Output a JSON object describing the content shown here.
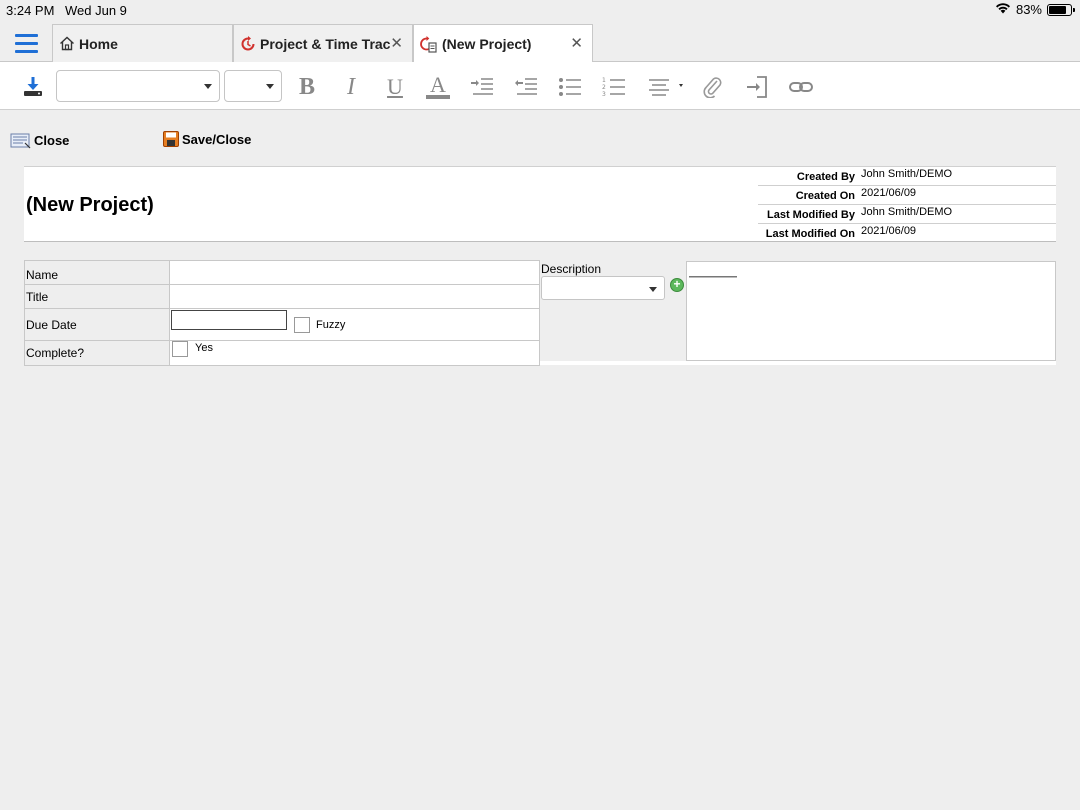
{
  "statusbar": {
    "time": "3:24 PM",
    "date": "Wed Jun 9",
    "battery": "83%"
  },
  "tabs": [
    {
      "label": "Home",
      "icon": "home-icon",
      "closable": false
    },
    {
      "label": "Project & Time Trac...",
      "icon": "refresh-clock-icon",
      "closable": true,
      "close": "✕"
    },
    {
      "label": "(New Project)",
      "icon": "new-doc-clock-icon",
      "closable": true,
      "close": "✕",
      "active": true
    }
  ],
  "toolbar": {
    "font_value": "",
    "size_value": "",
    "bold": "B",
    "italic": "I",
    "underline": "U",
    "font_color": "A"
  },
  "actions": {
    "close_label": "Close",
    "save_close_label": "Save/Close"
  },
  "header": {
    "title": "(New Project)",
    "meta": [
      {
        "label": "Created By",
        "value": "John Smith/DEMO"
      },
      {
        "label": "Created On",
        "value": "2021/06/09"
      },
      {
        "label": "Last Modified By",
        "value": "John Smith/DEMO"
      },
      {
        "label": "Last Modified On",
        "value": "2021/06/09"
      }
    ]
  },
  "form": {
    "name_label": "Name",
    "title_label": "Title",
    "due_date_label": "Due Date",
    "due_date_value": "",
    "fuzzy_label": "Fuzzy",
    "complete_label": "Complete?",
    "yes_label": "Yes"
  },
  "description": {
    "label": "Description",
    "select_value": "",
    "add_symbol": "+"
  },
  "colors": {
    "accent": "#1f6fd6",
    "tab_icon_red": "#d0312d",
    "add_green": "#5cb85c"
  }
}
